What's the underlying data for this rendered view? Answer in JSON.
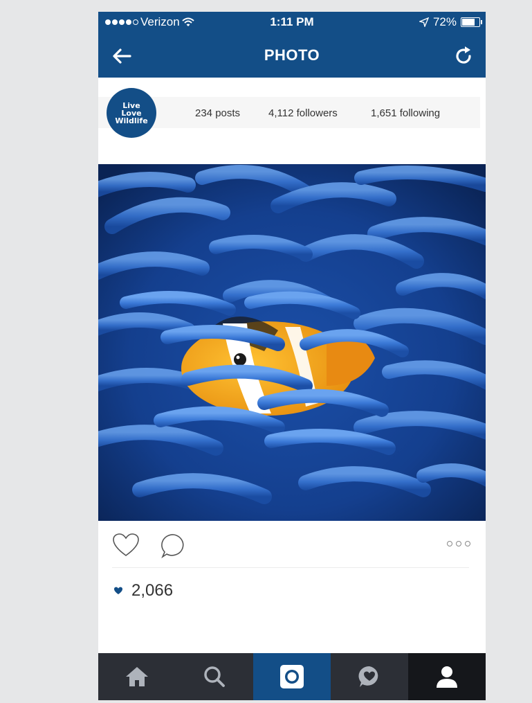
{
  "status_bar": {
    "carrier": "Verizon",
    "time": "1:11 PM",
    "battery_percent": "72%",
    "signal_bars_filled": 4,
    "signal_bars_total": 5
  },
  "nav": {
    "title": "PHOTO",
    "back_icon": "arrow-left-icon",
    "refresh_icon": "refresh-icon"
  },
  "profile": {
    "avatar_lines": [
      "Live",
      "Love",
      "Wildlife"
    ],
    "posts_count": "234",
    "posts_label": "posts",
    "followers_count": "4,112",
    "followers_label": "followers",
    "following_count": "1,651",
    "following_label": "following"
  },
  "post": {
    "likes_count": "2,066",
    "actions": [
      "heart-icon",
      "comment-icon",
      "more-icon"
    ]
  },
  "tabbar": {
    "items": [
      {
        "icon": "home-icon",
        "active": false
      },
      {
        "icon": "search-icon",
        "active": false
      },
      {
        "icon": "camera-icon",
        "active": true
      },
      {
        "icon": "activity-icon",
        "active": false
      },
      {
        "icon": "profile-icon",
        "active": false
      }
    ]
  },
  "colors": {
    "accent": "#134e87",
    "tabbar": "#2c2f36",
    "background": "#e6e7e8"
  }
}
